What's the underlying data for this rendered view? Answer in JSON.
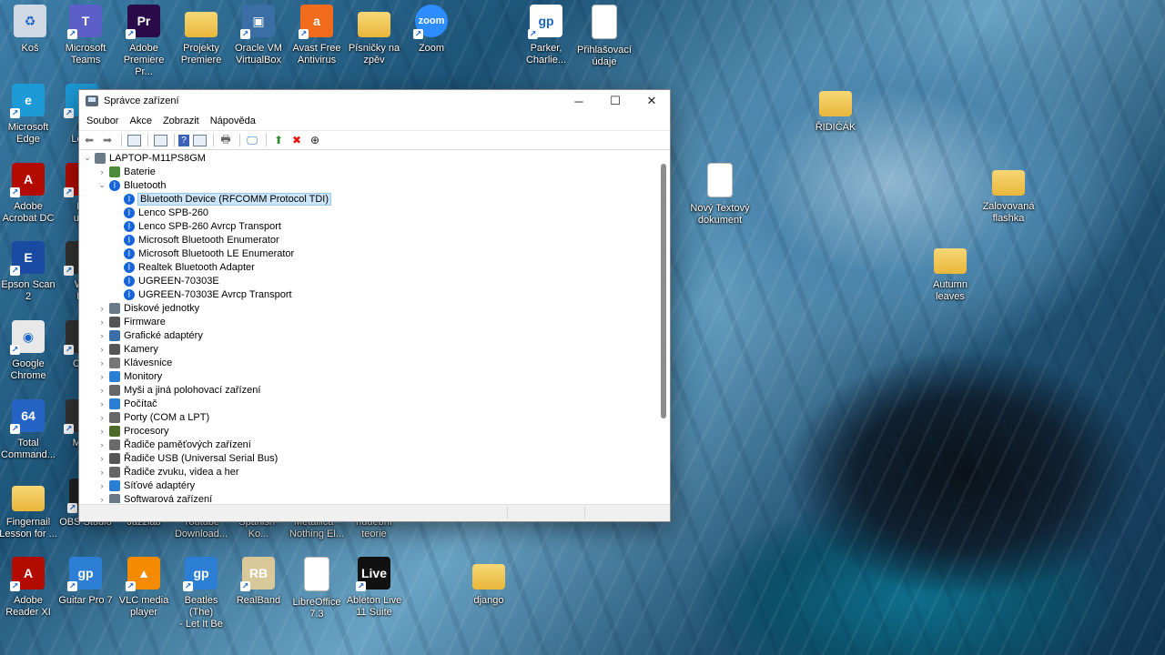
{
  "desktop": {
    "icons": [
      {
        "label": "Koš",
        "color": "#cfd8e3",
        "glyph": "♻"
      },
      {
        "label": "Microsoft\nTeams",
        "color": "#5b5fc7",
        "glyph": "T"
      },
      {
        "label": "Adobe\nPremiere Pr...",
        "color": "#2b0a4a",
        "glyph": "Pr"
      },
      {
        "label": "Projekty\nPremiere",
        "color": "folder",
        "glyph": ""
      },
      {
        "label": "Oracle VM\nVirtualBox",
        "color": "#3a6ea5",
        "glyph": "▣"
      },
      {
        "label": "Avast Free\nAntivirus",
        "color": "#f26b1d",
        "glyph": "a"
      },
      {
        "label": "Písničky na\nzpěv",
        "color": "folder",
        "glyph": ""
      },
      {
        "label": "Zoom",
        "color": "#2d8cff",
        "glyph": "zoom"
      },
      {
        "label": "Parker,\nCharlie...",
        "color": "#ffffff",
        "glyph": "gp"
      },
      {
        "label": "Přihlašovací\núdaje",
        "color": "doc",
        "glyph": ""
      },
      {
        "label": "Microsoft\nEdge",
        "color": "#1c9ad6",
        "glyph": "e"
      },
      {
        "label": "Fi\nLess",
        "color": "#1c9ad6",
        "glyph": ""
      },
      {
        "label": "Adobe\nAcrobat DC",
        "color": "#b30b00",
        "glyph": "A"
      },
      {
        "label": "Mi\nuTu",
        "color": "#b30b00",
        "glyph": ""
      },
      {
        "label": "Epson Scan 2",
        "color": "#1b4aa3",
        "glyph": "E"
      },
      {
        "label": "Wo\nFil",
        "color": "#333",
        "glyph": ""
      },
      {
        "label": "Google\nChrome",
        "color": "#e8e8e8",
        "glyph": "◉"
      },
      {
        "label": "Cho",
        "color": "#333",
        "glyph": ""
      },
      {
        "label": "Total\nCommand...",
        "color": "#2563c4",
        "glyph": "64"
      },
      {
        "label": "Mus",
        "color": "#333",
        "glyph": ""
      },
      {
        "label": "Fingernail\nLesson for ...",
        "color": "folder",
        "glyph": ""
      },
      {
        "label": "OBS Studio",
        "color": "#222",
        "glyph": "◎"
      },
      {
        "label": "Jazzlab",
        "color": "#333",
        "glyph": ""
      },
      {
        "label": "Youtube\nDownload...",
        "color": "#333",
        "glyph": ""
      },
      {
        "label": "Spanish-Ko...",
        "color": "#333",
        "glyph": ""
      },
      {
        "label": "Metallica -\nNothing El...",
        "color": "#333",
        "glyph": ""
      },
      {
        "label": "hudební\nteorie",
        "color": "#333",
        "glyph": ""
      },
      {
        "label": "Adobe\nReader XI",
        "color": "#b30b00",
        "glyph": "A"
      },
      {
        "label": "Guitar Pro 7",
        "color": "#2d7fd6",
        "glyph": "gp"
      },
      {
        "label": "VLC media\nplayer",
        "color": "#f48b00",
        "glyph": "▲"
      },
      {
        "label": "Beatles (The)\n- Let It Be",
        "color": "#2d7fd6",
        "glyph": "gp"
      },
      {
        "label": "RealBand",
        "color": "#d9c89a",
        "glyph": "RB"
      },
      {
        "label": "LibreOffice\n7.3",
        "color": "doc",
        "glyph": ""
      },
      {
        "label": "Ableton Live\n11 Suite",
        "color": "#111",
        "glyph": "Live"
      },
      {
        "label": "django",
        "color": "folder",
        "glyph": ""
      },
      {
        "label": "ŘIDIČÁK",
        "color": "folder",
        "glyph": ""
      },
      {
        "label": "Nový Textový\ndokument",
        "color": "doc",
        "glyph": ""
      },
      {
        "label": "Zalovovaná\nflashka",
        "color": "folder",
        "glyph": ""
      },
      {
        "label": "Autumn\nleaves",
        "color": "folder",
        "glyph": ""
      }
    ]
  },
  "window": {
    "title": "Správce zařízení",
    "menu": [
      "Soubor",
      "Akce",
      "Zobrazit",
      "Nápověda"
    ],
    "tree": {
      "root": "LAPTOP-M11PS8GM",
      "categories": [
        {
          "label": "Baterie",
          "expanded": false,
          "icon": "battery-icon"
        },
        {
          "label": "Bluetooth",
          "expanded": true,
          "icon": "bluetooth-icon",
          "children": [
            "Bluetooth Device (RFCOMM Protocol TDI)",
            "Lenco SPB-260",
            "Lenco SPB-260 Avrcp Transport",
            "Microsoft Bluetooth Enumerator",
            "Microsoft Bluetooth LE Enumerator",
            "Realtek Bluetooth Adapter",
            "UGREEN-70303E",
            "UGREEN-70303E Avrcp Transport"
          ]
        },
        {
          "label": "Diskové jednotky",
          "expanded": false,
          "icon": "disk-icon"
        },
        {
          "label": "Firmware",
          "expanded": false,
          "icon": "firmware-icon"
        },
        {
          "label": "Grafické adaptéry",
          "expanded": false,
          "icon": "display-adapter-icon"
        },
        {
          "label": "Kamery",
          "expanded": false,
          "icon": "camera-icon"
        },
        {
          "label": "Klávesnice",
          "expanded": false,
          "icon": "keyboard-icon"
        },
        {
          "label": "Monitory",
          "expanded": false,
          "icon": "monitor-icon"
        },
        {
          "label": "Myši a jiná polohovací zařízení",
          "expanded": false,
          "icon": "mouse-icon"
        },
        {
          "label": "Počítač",
          "expanded": false,
          "icon": "computer-icon"
        },
        {
          "label": "Porty (COM a LPT)",
          "expanded": false,
          "icon": "port-icon"
        },
        {
          "label": "Procesory",
          "expanded": false,
          "icon": "processor-icon"
        },
        {
          "label": "Řadiče paměťových zařízení",
          "expanded": false,
          "icon": "storage-controller-icon"
        },
        {
          "label": "Řadiče USB (Universal Serial Bus)",
          "expanded": false,
          "icon": "usb-icon"
        },
        {
          "label": "Řadiče zvuku, videa a her",
          "expanded": false,
          "icon": "sound-icon"
        },
        {
          "label": "Síťové adaptéry",
          "expanded": false,
          "icon": "network-icon"
        },
        {
          "label": "Softwarová zařízení",
          "expanded": false,
          "icon": "software-device-icon"
        }
      ],
      "selected": "Bluetooth Device (RFCOMM Protocol TDI)"
    }
  }
}
